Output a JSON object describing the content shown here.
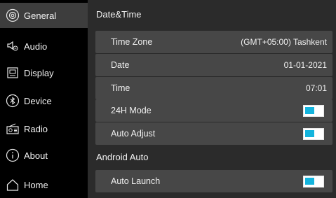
{
  "colors": {
    "accent": "#14b4dd",
    "sidebar_bg": "#000000",
    "main_bg": "#2b2b2b",
    "row_bg": "#474747"
  },
  "sidebar": {
    "items": [
      {
        "label": "General",
        "icon": "gear-icon",
        "active": true
      },
      {
        "label": "Audio",
        "icon": "speaker-icon",
        "active": false
      },
      {
        "label": "Display",
        "icon": "display-icon",
        "active": false
      },
      {
        "label": "Device",
        "icon": "bluetooth-icon",
        "active": false
      },
      {
        "label": "Radio",
        "icon": "radio-icon",
        "active": false
      },
      {
        "label": "About",
        "icon": "info-icon",
        "active": false
      },
      {
        "label": "Home",
        "icon": "home-icon",
        "active": false
      }
    ]
  },
  "main": {
    "datetime_title": "Date&Time",
    "time_zone": {
      "label": "Time Zone",
      "value": "(GMT+05:00) Tashkent"
    },
    "date": {
      "label": "Date",
      "value": "01-01-2021"
    },
    "time": {
      "label": "Time",
      "value": "07:01"
    },
    "mode_24h": {
      "label": "24H Mode",
      "on": true
    },
    "auto_adjust": {
      "label": "Auto Adjust",
      "on": true
    },
    "android_title": "Android Auto",
    "auto_launch": {
      "label": "Auto Launch",
      "on": true
    }
  }
}
